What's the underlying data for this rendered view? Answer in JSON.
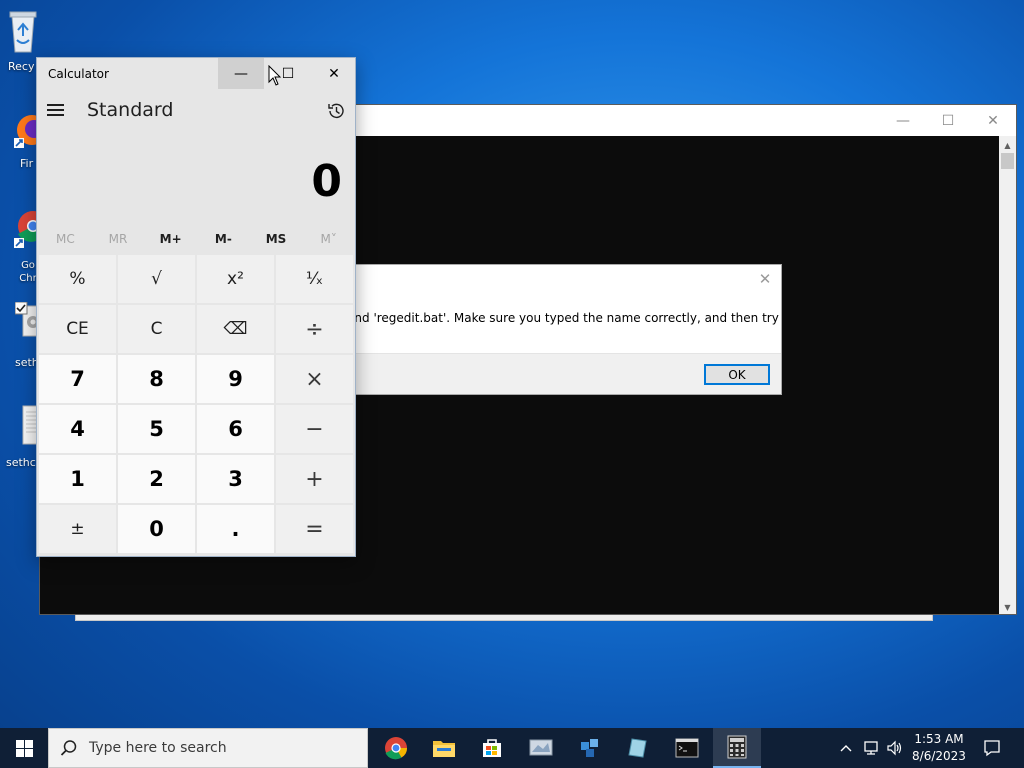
{
  "desktop": {
    "icons": [
      {
        "label": "Recy",
        "icon": "recycle-bin-icon"
      },
      {
        "label": "Fir",
        "icon": "firefox-icon"
      },
      {
        "label": "Go Chr",
        "icon": "chrome-icon"
      },
      {
        "label": "seth",
        "icon": "settings-file-icon"
      },
      {
        "label": "sethc",
        "icon": "file-icon"
      }
    ]
  },
  "console": {
    "title": "",
    "controls": {
      "minimize": "—",
      "maximize": "☐",
      "close": "✕"
    }
  },
  "dialog": {
    "message": "ot find 'regedit.bat'. Make sure you typed the name correctly, and then try",
    "ok_label": "OK",
    "close": "✕"
  },
  "calculator": {
    "window_title": "Calculator",
    "mode": "Standard",
    "display": "0",
    "controls": {
      "minimize": "—",
      "maximize": "☐",
      "close": "✕"
    },
    "memory_buttons": [
      {
        "label": "MC",
        "enabled": false
      },
      {
        "label": "MR",
        "enabled": false
      },
      {
        "label": "M+",
        "enabled": true
      },
      {
        "label": "M-",
        "enabled": true
      },
      {
        "label": "MS",
        "enabled": true
      },
      {
        "label": "M˅",
        "enabled": false
      }
    ],
    "keys": [
      {
        "label": "%",
        "kind": "fn",
        "name": "percent-button"
      },
      {
        "label": "√",
        "kind": "fn",
        "name": "square-root-button"
      },
      {
        "label": "x²",
        "kind": "fn",
        "name": "square-button"
      },
      {
        "label": "¹⁄ₓ",
        "kind": "fn",
        "name": "reciprocal-button"
      },
      {
        "label": "CE",
        "kind": "fn",
        "name": "clear-entry-button"
      },
      {
        "label": "C",
        "kind": "fn",
        "name": "clear-button"
      },
      {
        "label": "⌫",
        "kind": "fn",
        "name": "backspace-button"
      },
      {
        "label": "÷",
        "kind": "op",
        "name": "divide-button"
      },
      {
        "label": "7",
        "kind": "num",
        "name": "digit-7-button"
      },
      {
        "label": "8",
        "kind": "num",
        "name": "digit-8-button"
      },
      {
        "label": "9",
        "kind": "num",
        "name": "digit-9-button"
      },
      {
        "label": "×",
        "kind": "op",
        "name": "multiply-button"
      },
      {
        "label": "4",
        "kind": "num",
        "name": "digit-4-button"
      },
      {
        "label": "5",
        "kind": "num",
        "name": "digit-5-button"
      },
      {
        "label": "6",
        "kind": "num",
        "name": "digit-6-button"
      },
      {
        "label": "−",
        "kind": "op",
        "name": "subtract-button"
      },
      {
        "label": "1",
        "kind": "num",
        "name": "digit-1-button"
      },
      {
        "label": "2",
        "kind": "num",
        "name": "digit-2-button"
      },
      {
        "label": "3",
        "kind": "num",
        "name": "digit-3-button"
      },
      {
        "label": "+",
        "kind": "op",
        "name": "add-button"
      },
      {
        "label": "±",
        "kind": "fn",
        "name": "negate-button"
      },
      {
        "label": "0",
        "kind": "num",
        "name": "digit-0-button"
      },
      {
        "label": ".",
        "kind": "num",
        "name": "decimal-button"
      },
      {
        "label": "=",
        "kind": "op",
        "name": "equals-button"
      }
    ]
  },
  "taskbar": {
    "search_placeholder": "Type here to search",
    "apps": [
      {
        "name": "chrome-icon"
      },
      {
        "name": "file-explorer-icon"
      },
      {
        "name": "store-icon"
      },
      {
        "name": "app-icon-1"
      },
      {
        "name": "app-icon-2"
      },
      {
        "name": "app-icon-3"
      },
      {
        "name": "cmd-icon"
      },
      {
        "name": "calculator-icon"
      }
    ],
    "time": "1:53 AM",
    "date": "8/6/2023"
  },
  "colors": {
    "accent": "#0078d7",
    "taskbar": "#0f1f36",
    "calc_bg": "#e6e6e6"
  }
}
